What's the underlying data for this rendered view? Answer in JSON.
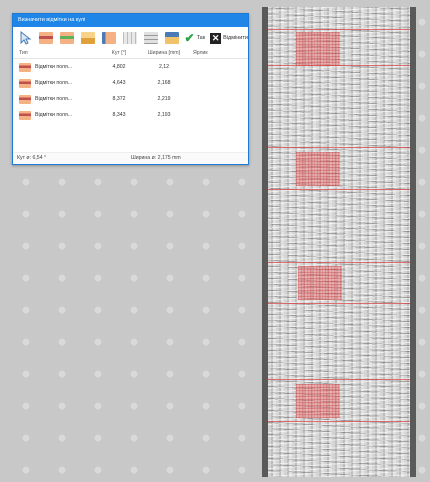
{
  "dialog": {
    "title": "Визначити відмітки на кулі",
    "toolbar": {
      "buttons": [
        {
          "name": "pointer-icon",
          "color": "#dfe8f3"
        },
        {
          "name": "sinusoid-add-icon",
          "color": "#e8a04d"
        },
        {
          "name": "sinusoid-green-icon",
          "color": "#5fb15a"
        },
        {
          "name": "layer-icon",
          "color": "#f0c36a"
        },
        {
          "name": "sinusoid-edit-icon",
          "color": "#e1955e"
        },
        {
          "name": "grid-icon",
          "color": "#cfcfcf"
        },
        {
          "name": "table-icon",
          "color": "#bdbdbd"
        },
        {
          "name": "export-icon",
          "color": "#d9b66a"
        }
      ],
      "ok_label": "Так",
      "cancel_label": "Відмінити"
    },
    "table": {
      "headers": {
        "type": "Тип",
        "angle": "Кут [°]",
        "width": "Ширина [mm]",
        "label": "Ярлик"
      },
      "rows": [
        {
          "type": "Відмітки поля...",
          "angle": "4,802",
          "width": "2,12",
          "label": ""
        },
        {
          "type": "Відмітки поля...",
          "angle": "4,643",
          "width": "2,168",
          "label": ""
        },
        {
          "type": "Відмітки поля...",
          "angle": "8,372",
          "width": "2,219",
          "label": ""
        },
        {
          "type": "Відмітки поля...",
          "angle": "8,343",
          "width": "2,193",
          "label": ""
        }
      ]
    },
    "status": {
      "angle": "Кут ø: 6,54 °",
      "width": "Ширина ø: 2,175 mm"
    }
  },
  "colors": {
    "titlebar": "#1f86e8",
    "highlight": "#eb6e6e"
  }
}
